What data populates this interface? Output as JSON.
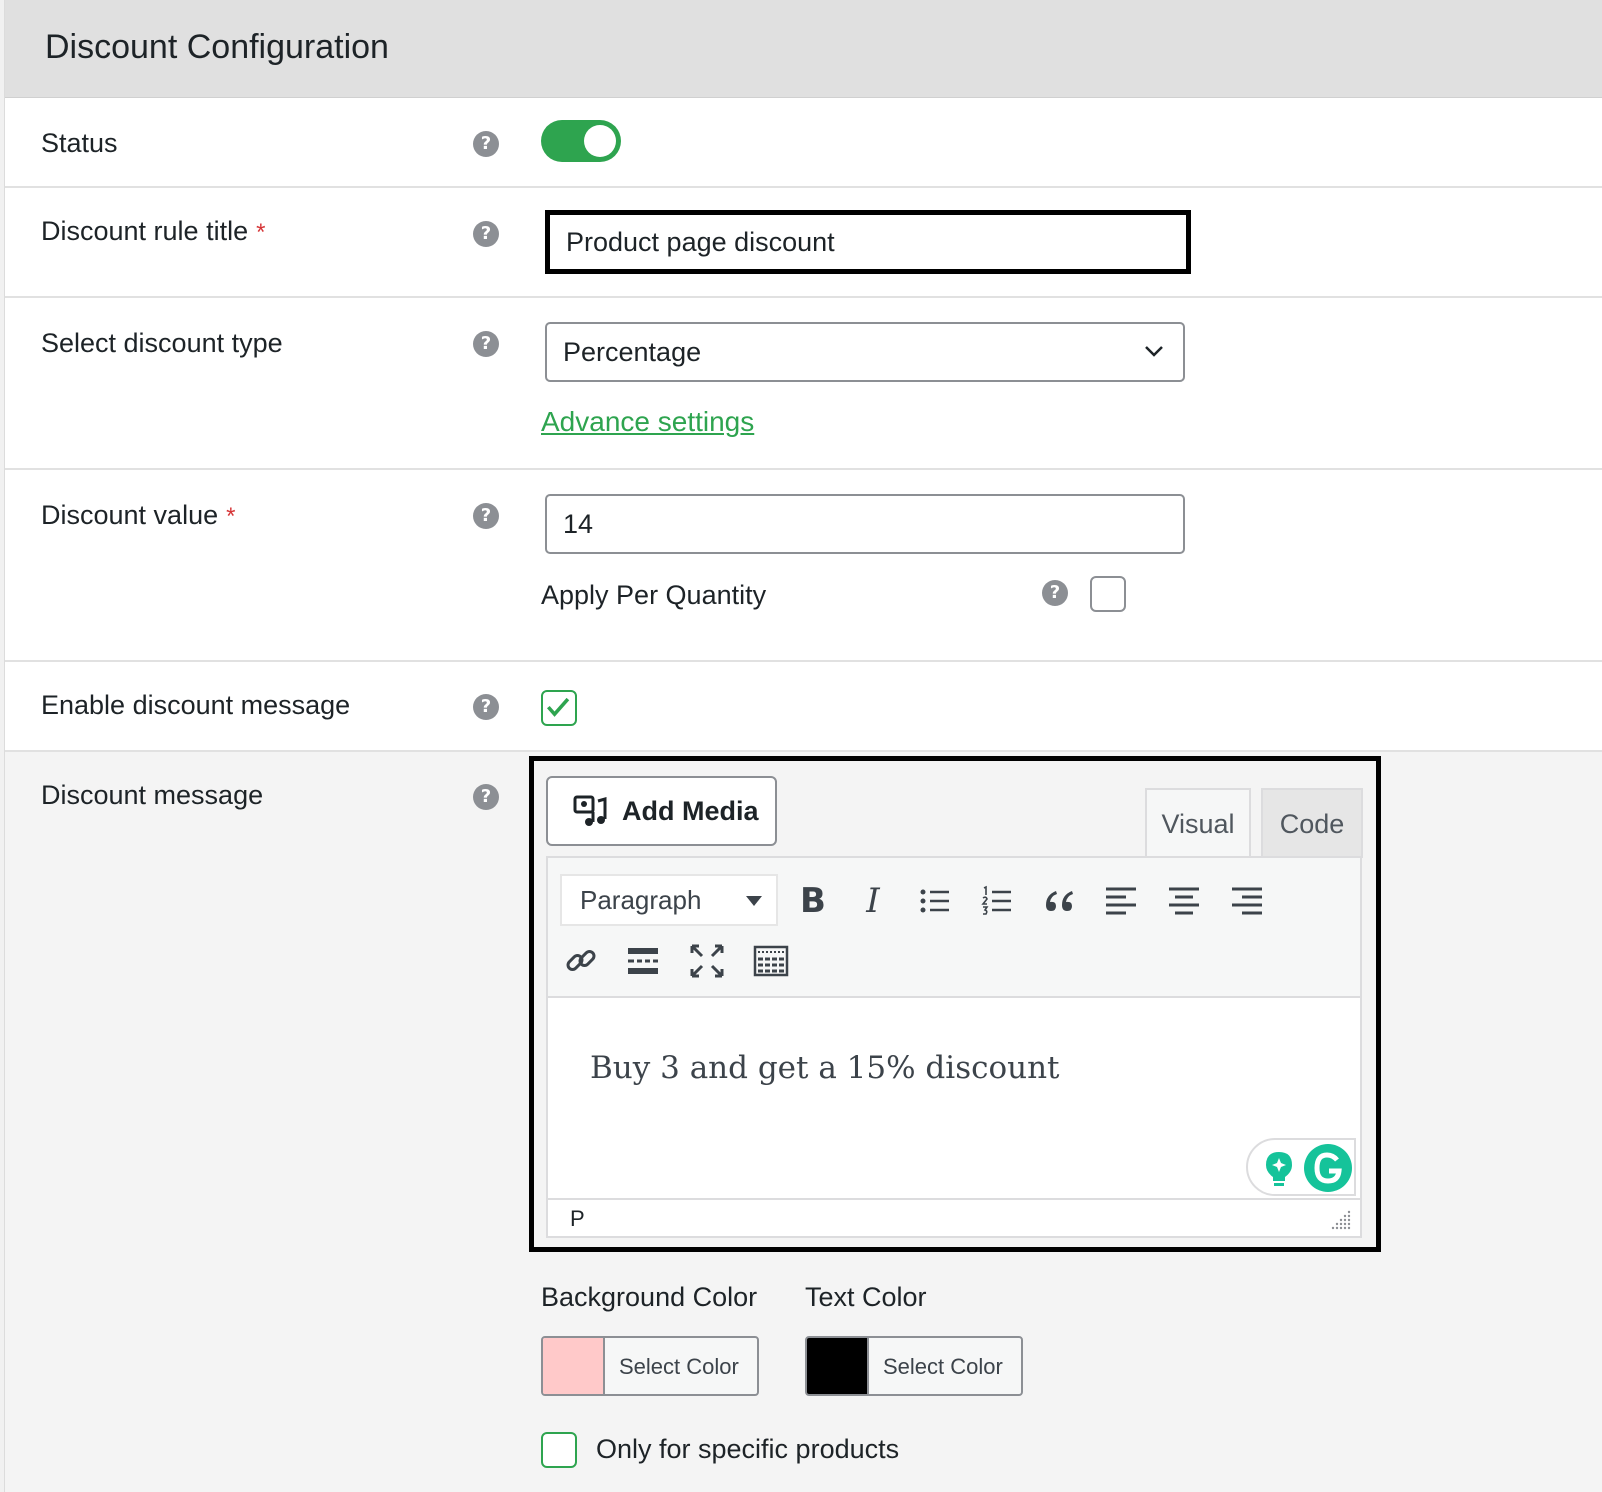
{
  "header": {
    "title": "Discount Configuration"
  },
  "rows": {
    "status": {
      "label": "Status",
      "enabled": true
    },
    "rule_title": {
      "label": "Discount rule title",
      "required_mark": "*",
      "value": "Product page discount"
    },
    "discount_type": {
      "label": "Select discount type",
      "selected": "Percentage",
      "link": "Advance settings"
    },
    "discount_value": {
      "label": "Discount value",
      "required_mark": "*",
      "value": "14",
      "apply_per_quantity_label": "Apply Per Quantity",
      "apply_per_quantity_checked": false
    },
    "enable_message": {
      "label": "Enable discount message",
      "checked": true
    },
    "discount_message": {
      "label": "Discount message"
    }
  },
  "help_icon": "?",
  "editor": {
    "add_media_label": "Add Media",
    "tabs": {
      "visual": "Visual",
      "code": "Code"
    },
    "format_selected": "Paragraph",
    "toolbar_icons": [
      "bold-icon",
      "italic-icon",
      "bullet-list-icon",
      "numbered-list-icon",
      "blockquote-icon",
      "align-left-icon",
      "align-center-icon",
      "align-right-icon",
      "link-icon",
      "read-more-icon",
      "fullscreen-icon",
      "toolbar-toggle-icon"
    ],
    "content": "Buy 3 and get a 15% discount",
    "path": "P"
  },
  "colors": {
    "background_color_label": "Background Color",
    "text_color_label": "Text Color",
    "select_color_label": "Select Color",
    "background_swatch": "#ffc9c9",
    "text_swatch": "#000000"
  },
  "specific_products": {
    "label": "Only for specific products",
    "checked": false
  },
  "accent": "#2ea44f"
}
